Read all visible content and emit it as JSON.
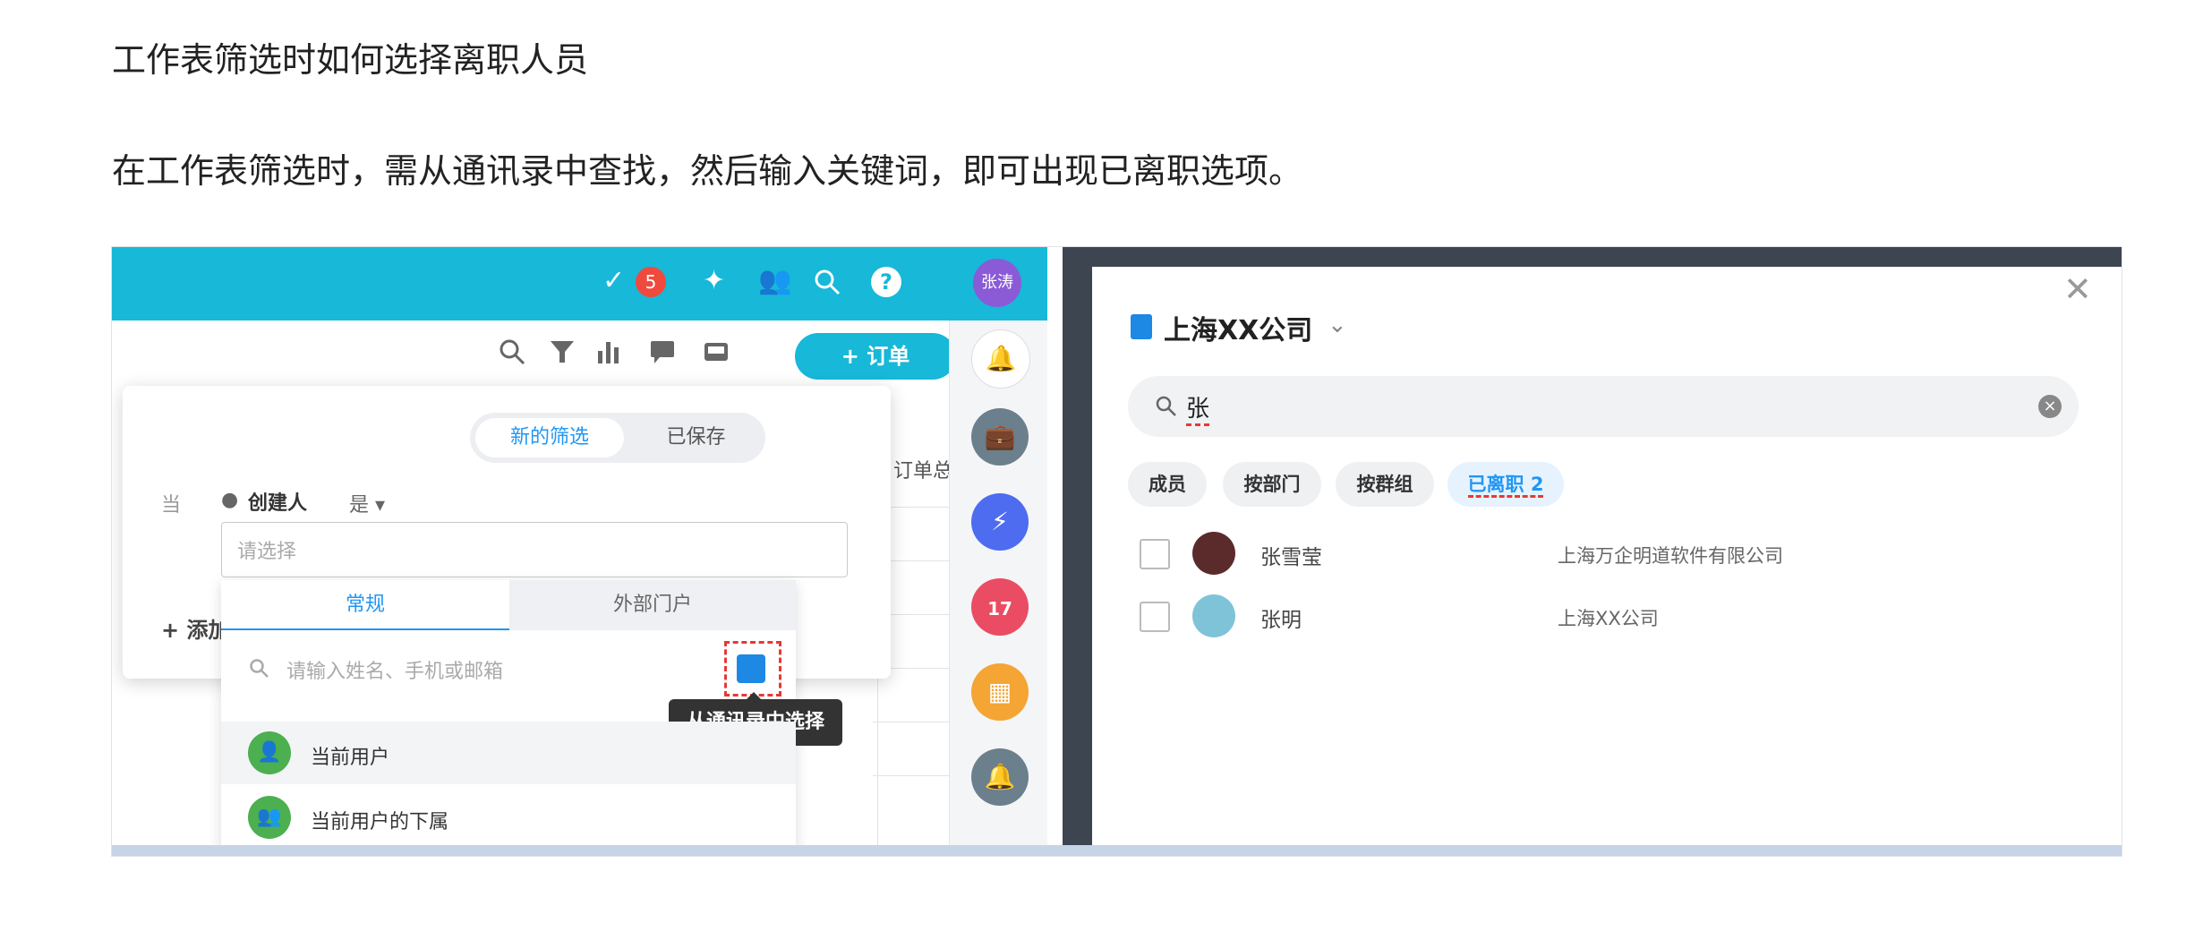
{
  "doc": {
    "title": "工作表筛选时如何选择离职人员",
    "paragraph": "在工作表筛选时，需从通讯录中查找，然后输入关键词，即可出现已离职选项。"
  },
  "left_app": {
    "topbar": {
      "badge_count": "5",
      "avatar_label": "张涛",
      "icons": [
        "check-circle-icon",
        "magic-icon",
        "people-icon",
        "search-icon",
        "help-icon"
      ]
    },
    "toolbar": {
      "add_order_label": "+ 订单",
      "icons": [
        "search-icon",
        "filter-icon",
        "chart-icon",
        "comment-icon",
        "inbox-icon"
      ]
    },
    "column_header": "订单总",
    "filter": {
      "tabs": [
        "新的筛选",
        "已保存"
      ],
      "when_label": "当",
      "field_label": "创建人",
      "operator_label": "是 ▾",
      "select_placeholder": "请选择",
      "add_condition_label": "+ 添加"
    },
    "picker": {
      "tabs": [
        "常规",
        "外部门户"
      ],
      "search_placeholder": "请输入姓名、手机或邮箱",
      "tooltip": "从通讯录中选择",
      "options": [
        "当前用户",
        "当前用户的下属"
      ]
    },
    "sidebar_icons": [
      "bell-icon",
      "briefcase-icon",
      "bolt-icon",
      "calendar-icon",
      "grid-icon",
      "notification-icon"
    ],
    "calendar_day": "17"
  },
  "right_dialog": {
    "company": "上海XX公司",
    "search_value": "张",
    "chips": [
      "成员",
      "按部门",
      "按群组",
      "已离职 2"
    ],
    "results": [
      {
        "name": "张雪莹",
        "org": "上海万企明道软件有限公司"
      },
      {
        "name": "张明",
        "org": "上海XX公司"
      }
    ]
  },
  "colors": {
    "accent": "#17b8d8",
    "link_blue": "#2196f3",
    "badge_red": "#f04a3e",
    "highlight_red": "#e53935"
  }
}
